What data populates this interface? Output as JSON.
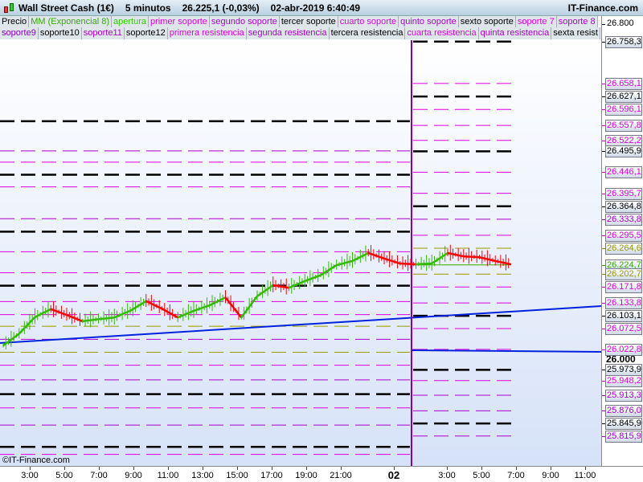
{
  "header": {
    "instrument": "Wall Street Cash (1€)",
    "timeframe": "5 minutos",
    "quote": "26.225,1 (-0,03%)",
    "datetime": "02-abr-2019 6:40:49",
    "site": "IT-Finance.com"
  },
  "legend_row1": [
    {
      "label": "Precio",
      "color": "#000000"
    },
    {
      "label": "MM (Exponencial 8)",
      "color": "#33aa00"
    },
    {
      "label": "apertura",
      "color": "#33cc00"
    },
    {
      "label": "primer soporte",
      "color": "#dd00dd"
    },
    {
      "label": "segundo soporte",
      "color": "#aa00cc"
    },
    {
      "label": "tercer soporte",
      "color": "#000000"
    },
    {
      "label": "cuarto soporte",
      "color": "#dd00dd"
    },
    {
      "label": "quinto soporte",
      "color": "#aa00cc"
    },
    {
      "label": "sexto soporte",
      "color": "#000000"
    },
    {
      "label": "soporte 7",
      "color": "#dd00dd"
    },
    {
      "label": "soporte 8",
      "color": "#aa00cc"
    }
  ],
  "legend_row2": [
    {
      "label": "soporte9",
      "color": "#8800cc"
    },
    {
      "label": "soporte10",
      "color": "#000000"
    },
    {
      "label": "soporte11",
      "color": "#aa00cc"
    },
    {
      "label": "soporte12",
      "color": "#000000"
    },
    {
      "label": "primera resistencia",
      "color": "#dd00dd"
    },
    {
      "label": "segunda resistencia",
      "color": "#aa00cc"
    },
    {
      "label": "tercera resistencia",
      "color": "#000000"
    },
    {
      "label": "cuarta resistencia",
      "color": "#dd00dd"
    },
    {
      "label": "quinta resistencia",
      "color": "#aa00cc"
    },
    {
      "label": "sexta resist",
      "color": "#000000"
    }
  ],
  "price_axis": {
    "top_tick": "26.800",
    "mid_tick": "26.000",
    "labels": [
      {
        "text": "26.758,3",
        "value": 26.7583,
        "color": "#000000",
        "style": "thick"
      },
      {
        "text": "26.658,1",
        "value": 26.6581,
        "color": "#dd00dd",
        "style": "thin"
      },
      {
        "text": "26.627,1",
        "value": 26.6271,
        "color": "#000000",
        "style": "thick"
      },
      {
        "text": "26.596,1",
        "value": 26.5961,
        "color": "#dd00dd",
        "style": "thin"
      },
      {
        "text": "26.557,8",
        "value": 26.5578,
        "color": "#dd00dd",
        "style": "thin"
      },
      {
        "text": "26.522,2",
        "value": 26.5222,
        "color": "#dd00dd",
        "style": "thin"
      },
      {
        "text": "26.495,9",
        "value": 26.4959,
        "color": "#000000",
        "style": "thick"
      },
      {
        "text": "26.446,1",
        "value": 26.4461,
        "color": "#dd00dd",
        "style": "thin"
      },
      {
        "text": "26.395,7",
        "value": 26.3957,
        "color": "#dd00dd",
        "style": "thin"
      },
      {
        "text": "26.364,8",
        "value": 26.3648,
        "color": "#000000",
        "style": "thick"
      },
      {
        "text": "26.333,8",
        "value": 26.3338,
        "color": "#aa00cc",
        "style": "thin"
      },
      {
        "text": "26.295,5",
        "value": 26.2955,
        "color": "#dd00dd",
        "style": "thin"
      },
      {
        "text": "26.264,6",
        "value": 26.2646,
        "color": "#999900",
        "style": "thin"
      },
      {
        "text": "26.224,7",
        "value": 26.2247,
        "color": "#33aa00",
        "style": "solid"
      },
      {
        "text": "26.202,7",
        "value": 26.2027,
        "color": "#999900",
        "style": "thin"
      },
      {
        "text": "26.171,8",
        "value": 26.1718,
        "color": "#dd00dd",
        "style": "thin"
      },
      {
        "text": "26.133,8",
        "value": 26.1338,
        "color": "#dd00dd",
        "style": "thin"
      },
      {
        "text": "26.103,1",
        "value": 26.1031,
        "color": "#000000",
        "style": "thick"
      },
      {
        "text": "26.072,5",
        "value": 26.0725,
        "color": "#dd00dd",
        "style": "thin"
      },
      {
        "text": "26.022,8",
        "value": 26.0228,
        "color": "#dd00dd",
        "style": "thin"
      },
      {
        "text": "25.973,9",
        "value": 25.9739,
        "color": "#000000",
        "style": "thick"
      },
      {
        "text": "25.948,2",
        "value": 25.9482,
        "color": "#dd00dd",
        "style": "thin"
      },
      {
        "text": "25.913,3",
        "value": 25.9133,
        "color": "#aa00cc",
        "style": "thin"
      },
      {
        "text": "25.876,0",
        "value": 25.876,
        "color": "#aa00cc",
        "style": "thin"
      },
      {
        "text": "25.845,9",
        "value": 25.8459,
        "color": "#000000",
        "style": "thick"
      },
      {
        "text": "25.815,9",
        "value": 25.8159,
        "color": "#aa00cc",
        "style": "thin"
      }
    ]
  },
  "prev_day_levels": [
    {
      "value": 26.568,
      "color": "#000000",
      "style": "thick"
    },
    {
      "value": 26.47,
      "color": "#dd00dd",
      "style": "thin"
    },
    {
      "value": 26.44,
      "color": "#000000",
      "style": "thick"
    },
    {
      "value": 26.411,
      "color": "#dd00dd",
      "style": "thin"
    },
    {
      "value": 26.497,
      "color": "#aa00cc",
      "style": "thin"
    },
    {
      "value": 26.335,
      "color": "#aa00cc",
      "style": "thin"
    },
    {
      "value": 26.304,
      "color": "#000000",
      "style": "thick"
    },
    {
      "value": 26.256,
      "color": "#dd00dd",
      "style": "thin"
    },
    {
      "value": 26.206,
      "color": "#dd00dd",
      "style": "thin"
    },
    {
      "value": 26.175,
      "color": "#000000",
      "style": "thick"
    },
    {
      "value": 26.137,
      "color": "#dd00dd",
      "style": "thin"
    },
    {
      "value": 26.106,
      "color": "#dd00dd",
      "style": "thin"
    },
    {
      "value": 26.078,
      "color": "#999900",
      "style": "thin"
    },
    {
      "value": 26.047,
      "color": "#aa00cc",
      "style": "thin"
    },
    {
      "value": 26.016,
      "color": "#999900",
      "style": "thin"
    },
    {
      "value": 25.985,
      "color": "#dd00dd",
      "style": "thin"
    },
    {
      "value": 25.95,
      "color": "#aa00cc",
      "style": "thin"
    },
    {
      "value": 25.916,
      "color": "#000000",
      "style": "thick"
    },
    {
      "value": 25.883,
      "color": "#dd00dd",
      "style": "thin"
    },
    {
      "value": 25.842,
      "color": "#aa00cc",
      "style": "thin"
    },
    {
      "value": 25.79,
      "color": "#000000",
      "style": "thick"
    },
    {
      "value": 25.772,
      "color": "#dd00dd",
      "style": "thin"
    }
  ],
  "price_series": [
    26.032,
    26.06,
    26.1,
    26.119,
    26.105,
    26.09,
    26.095,
    26.099,
    26.115,
    26.138,
    26.12,
    26.099,
    26.115,
    26.128,
    26.147,
    26.099,
    26.15,
    26.176,
    26.17,
    26.186,
    26.2,
    26.224,
    26.234,
    26.253,
    26.24,
    26.228,
    26.226,
    26.228,
    26.253,
    26.245,
    26.243,
    26.234,
    26.226
  ],
  "time_axis": [
    "3:00",
    "5:00",
    "7:00",
    "9:00",
    "11:00",
    "13:00",
    "15:00",
    "17:00",
    "19:00",
    "21:00",
    "02",
    "3:00",
    "5:00",
    "7:00",
    "9:00",
    "11:00"
  ],
  "copyright": "©IT-Finance.com",
  "colors": {
    "up": "#33bb00",
    "down": "#ff0000",
    "trend": "#0022dd",
    "separator": "#8800aa"
  }
}
